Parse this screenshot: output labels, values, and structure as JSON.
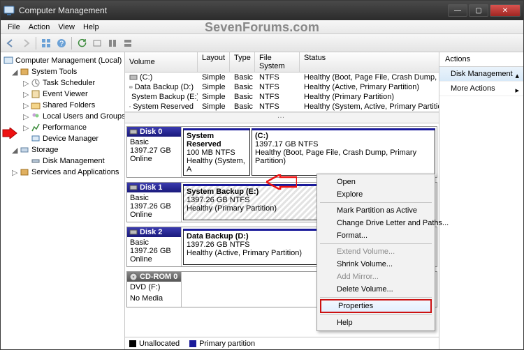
{
  "window": {
    "title": "Computer Management"
  },
  "watermark": "SevenForums.com",
  "menu": {
    "file": "File",
    "action": "Action",
    "view": "View",
    "help": "Help"
  },
  "tree": {
    "root": "Computer Management (Local)",
    "system_tools": "System Tools",
    "task_scheduler": "Task Scheduler",
    "event_viewer": "Event Viewer",
    "shared_folders": "Shared Folders",
    "local_users": "Local Users and Groups",
    "performance": "Performance",
    "device_manager": "Device Manager",
    "storage": "Storage",
    "disk_management": "Disk Management",
    "services_apps": "Services and Applications"
  },
  "vol_headers": {
    "volume": "Volume",
    "layout": "Layout",
    "type": "Type",
    "fs": "File System",
    "status": "Status"
  },
  "volumes": [
    {
      "name": "(C:)",
      "layout": "Simple",
      "type": "Basic",
      "fs": "NTFS",
      "status": "Healthy (Boot, Page File, Crash Dump, Primary Partitio"
    },
    {
      "name": "Data Backup (D:)",
      "layout": "Simple",
      "type": "Basic",
      "fs": "NTFS",
      "status": "Healthy (Active, Primary Partition)"
    },
    {
      "name": "System Backup (E:)",
      "layout": "Simple",
      "type": "Basic",
      "fs": "NTFS",
      "status": "Healthy (Primary Partition)"
    },
    {
      "name": "System Reserved",
      "layout": "Simple",
      "type": "Basic",
      "fs": "NTFS",
      "status": "Healthy (System, Active, Primary Partition)"
    }
  ],
  "disks": {
    "d0": {
      "name": "Disk 0",
      "type": "Basic",
      "size": "1397.27 GB",
      "status": "Online",
      "p0": {
        "name": "System Reserved",
        "line2": "100 MB NTFS",
        "line3": "Healthy (System, A"
      },
      "p1": {
        "name": "(C:)",
        "line2": "1397.17 GB NTFS",
        "line3": "Healthy (Boot, Page File, Crash Dump, Primary Partition)"
      }
    },
    "d1": {
      "name": "Disk 1",
      "type": "Basic",
      "size": "1397.26 GB",
      "status": "Online",
      "p0": {
        "name": "System Backup  (E:)",
        "line2": "1397.26 GB NTFS",
        "line3": "Healthy (Primary Partition)"
      }
    },
    "d2": {
      "name": "Disk 2",
      "type": "Basic",
      "size": "1397.26 GB",
      "status": "Online",
      "p0": {
        "name": "Data Backup  (D:)",
        "line2": "1397.26 GB NTFS",
        "line3": "Healthy (Active, Primary Partition)"
      }
    },
    "cd": {
      "name": "CD-ROM 0",
      "type": "DVD (F:)",
      "status": "No Media"
    }
  },
  "legend": {
    "unalloc": "Unallocated",
    "primary": "Primary partition"
  },
  "actions": {
    "header": "Actions",
    "dm": "Disk Management",
    "more": "More Actions"
  },
  "ctx": {
    "open": "Open",
    "explore": "Explore",
    "mark": "Mark Partition as Active",
    "change": "Change Drive Letter and Paths...",
    "format": "Format...",
    "extend": "Extend Volume...",
    "shrink": "Shrink Volume...",
    "mirror": "Add Mirror...",
    "delete": "Delete Volume...",
    "props": "Properties",
    "help": "Help"
  }
}
